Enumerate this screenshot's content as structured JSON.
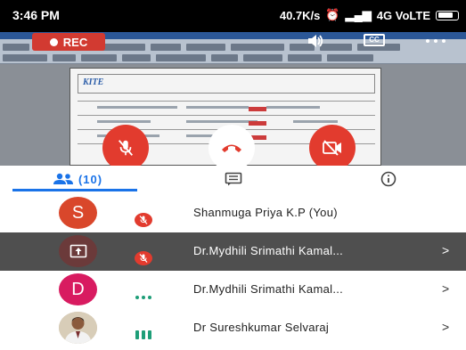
{
  "status_bar": {
    "time": "3:46 PM",
    "right_text": "40.7K/s",
    "signal_text": "4G VoLTE"
  },
  "call": {
    "rec_label": "REC",
    "cc_label": "CC",
    "mic_state": "muted",
    "camera_state": "off",
    "document_logo": "KITE"
  },
  "tabs": {
    "people_count": "(10)",
    "chat_icon": "chat-icon",
    "info_icon": "info-icon"
  },
  "participants": [
    {
      "avatar_letter": "S",
      "avatar_color": "#d9472b",
      "name": "Shanmuga Priya K.P (You)",
      "indicator": "muted",
      "has_chevron": false
    },
    {
      "avatar_letter": "",
      "avatar_color": "#6b3a3a",
      "name": "Dr.Mydhili Srimathi Kamal...",
      "indicator": "muted",
      "has_chevron": true,
      "chevron": ">"
    },
    {
      "avatar_letter": "D",
      "avatar_color": "#d81b60",
      "name": "Dr.Mydhili Srimathi Kamal...",
      "indicator": "dots",
      "has_chevron": true,
      "chevron": ">"
    },
    {
      "avatar_letter": "",
      "avatar_color": "#b7a58a",
      "name": "Dr Sureshkumar Selvaraj",
      "indicator": "speaking",
      "has_chevron": true,
      "chevron": ">"
    }
  ],
  "colors": {
    "accent": "#1a73e8",
    "danger": "#e23b2e",
    "active_green": "#1e9e78"
  }
}
